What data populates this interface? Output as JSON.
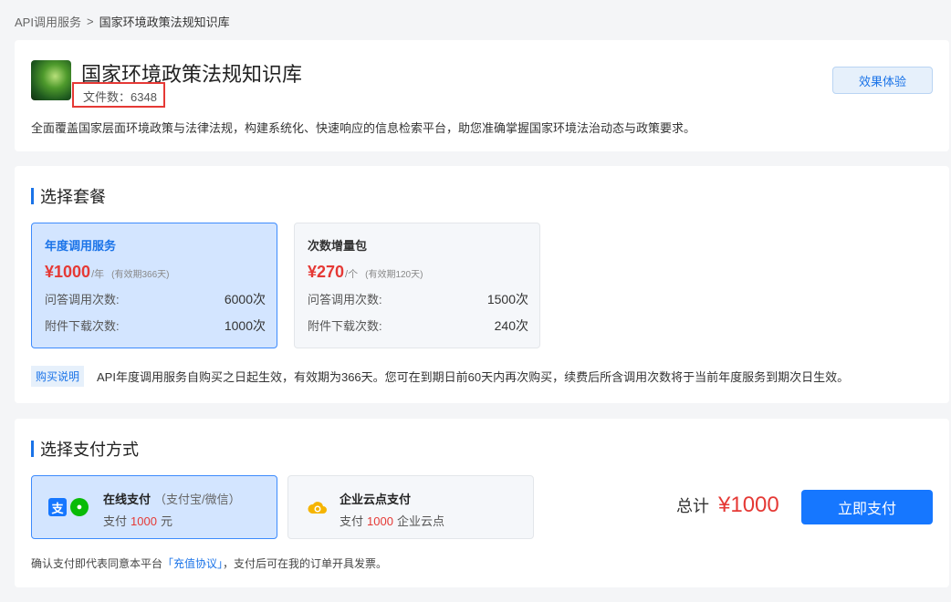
{
  "breadcrumb": {
    "parent": "API调用服务",
    "separator": ">",
    "current": "国家环境政策法规知识库"
  },
  "kb": {
    "title": "国家环境政策法规知识库",
    "file_count_label": "文件数：6348",
    "description": "全面覆盖国家层面环境政策与法律法规，构建系统化、快速响应的信息检索平台，助您准确掌握国家环境法治动态与政策要求。",
    "try_button": "效果体验"
  },
  "plans": {
    "section_title": "选择套餐",
    "items": [
      {
        "name": "年度调用服务",
        "price": "¥1000",
        "unit": "/年",
        "validity": "(有效期366天)",
        "rows": [
          {
            "label": "问答调用次数:",
            "value": "6000次"
          },
          {
            "label": "附件下载次数:",
            "value": "1000次"
          }
        ],
        "selected": true
      },
      {
        "name": "次数增量包",
        "price": "¥270",
        "unit": "/个",
        "validity": "(有效期120天)",
        "rows": [
          {
            "label": "问答调用次数:",
            "value": "1500次"
          },
          {
            "label": "附件下载次数:",
            "value": "240次"
          }
        ],
        "selected": false
      }
    ],
    "note_tag": "购买说明",
    "note_text": "API年度调用服务自购买之日起生效，有效期为366天。您可在到期日前60天内再次购买，续费后所含调用次数将于当前年度服务到期次日生效。"
  },
  "payment": {
    "section_title": "选择支付方式",
    "options": [
      {
        "title": "在线支付",
        "subtitle": "（支付宝/微信）",
        "amount_prefix": "支付",
        "amount": "1000",
        "amount_suffix": "元",
        "icons": [
          "alipay-icon",
          "wechat-icon"
        ],
        "selected": true
      },
      {
        "title": "企业云点支付",
        "subtitle": "",
        "amount_prefix": "支付",
        "amount": "1000",
        "amount_suffix": "企业云点",
        "icons": [
          "cloud-coin-icon"
        ],
        "selected": false
      }
    ],
    "total_label": "总计",
    "total_value": "¥1000",
    "pay_button": "立即支付",
    "agree_prefix": "确认支付即代表同意本平台",
    "agree_link": "「充值协议」",
    "agree_suffix": "，支付后可在我的订单开具发票。"
  },
  "colors": {
    "accent": "#1677ff",
    "price_red": "#e53935",
    "selected_bg": "#d3e5ff"
  }
}
